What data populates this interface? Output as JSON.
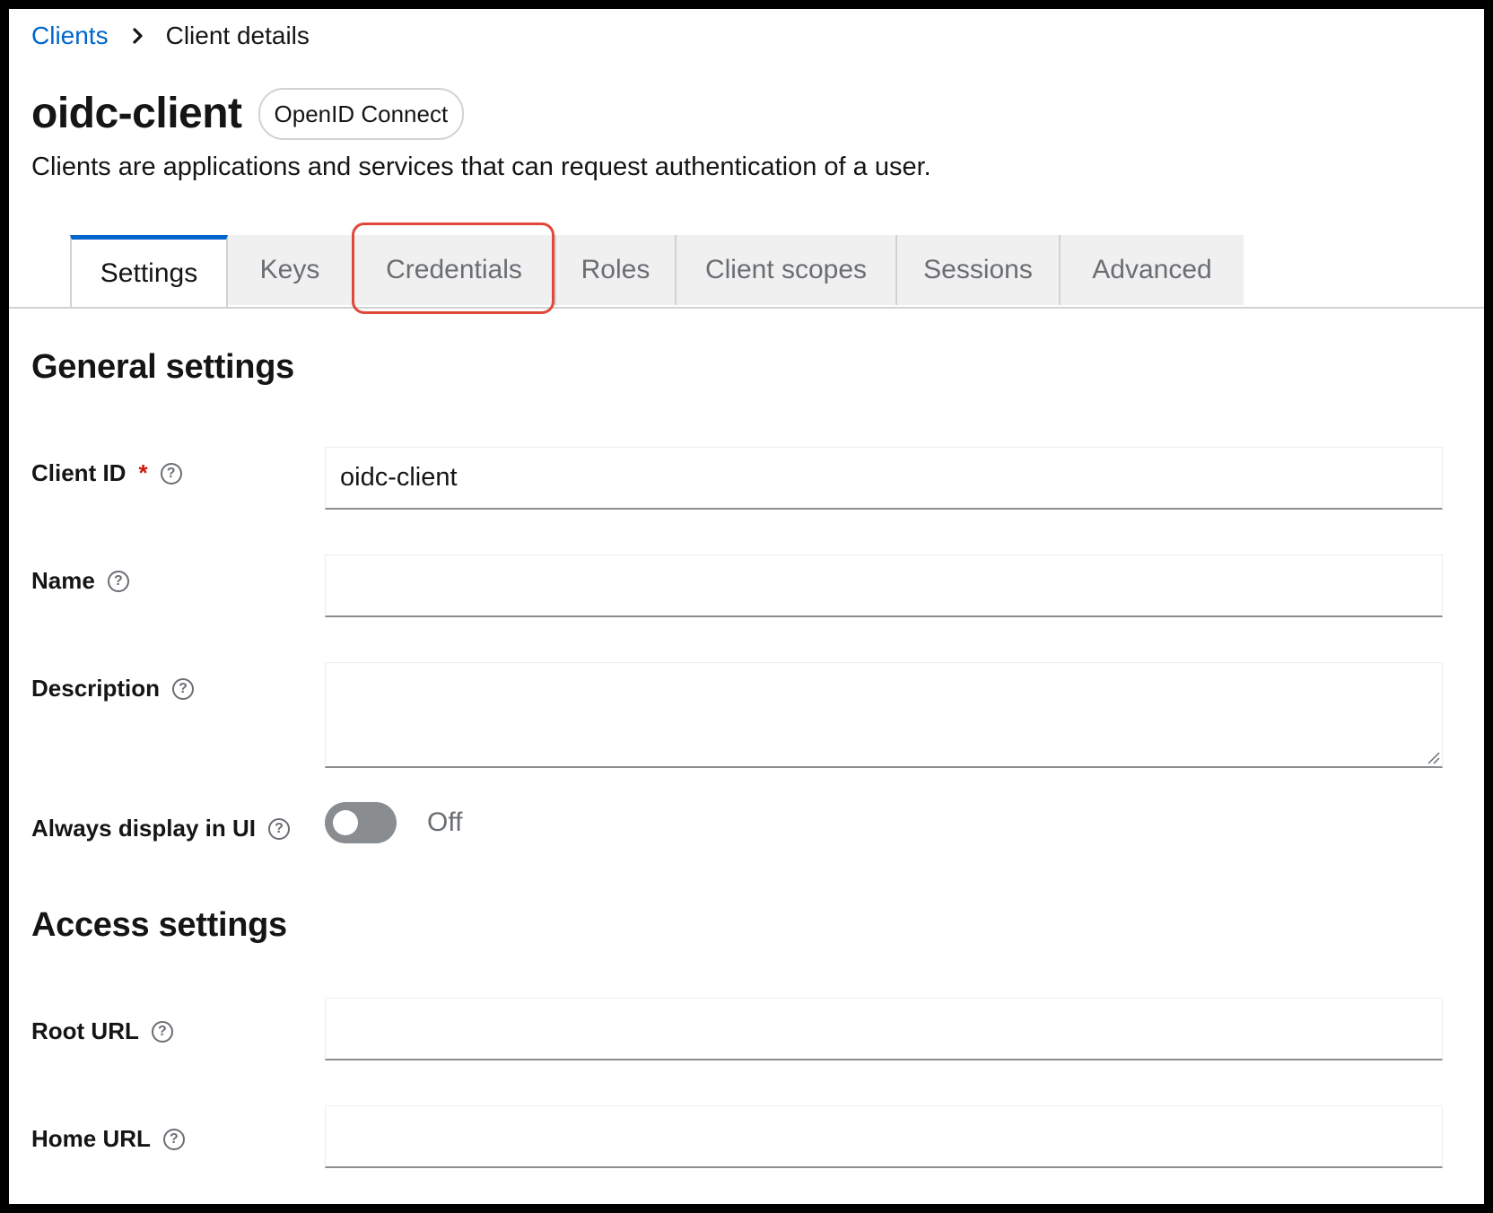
{
  "breadcrumb": {
    "parent": "Clients",
    "current": "Client details"
  },
  "header": {
    "title": "oidc-client",
    "protocol_badge": "OpenID Connect",
    "subtitle": "Clients are applications and services that can request authentication of a user."
  },
  "tabs": [
    {
      "label": "Settings",
      "active": true
    },
    {
      "label": "Keys",
      "active": false
    },
    {
      "label": "Credentials",
      "active": false,
      "highlighted": true
    },
    {
      "label": "Roles",
      "active": false
    },
    {
      "label": "Client scopes",
      "active": false
    },
    {
      "label": "Sessions",
      "active": false
    },
    {
      "label": "Advanced",
      "active": false
    }
  ],
  "general_settings": {
    "title": "General settings",
    "client_id": {
      "label": "Client ID",
      "required_mark": "*",
      "value": "oidc-client"
    },
    "name": {
      "label": "Name",
      "value": ""
    },
    "description": {
      "label": "Description",
      "value": ""
    },
    "always_display": {
      "label": "Always display in UI",
      "state_text": "Off",
      "on": false
    }
  },
  "access_settings": {
    "title": "Access settings",
    "root_url": {
      "label": "Root URL",
      "value": ""
    },
    "home_url": {
      "label": "Home URL",
      "value": ""
    }
  },
  "icons": {
    "help": "question-circle-icon",
    "separator": "chevron-right-icon"
  },
  "colors": {
    "link": "#0066cc",
    "active_tab_border": "#0066cc",
    "highlight_box": "#e0483a",
    "required": "#c9190b"
  }
}
